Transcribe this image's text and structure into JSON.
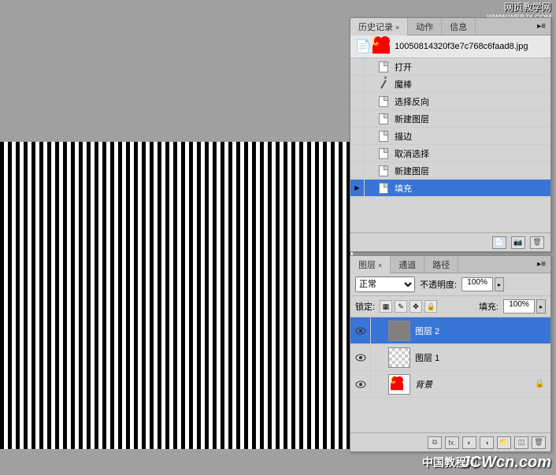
{
  "watermarks": {
    "top_title": "网页教学网",
    "top_url": "WWW.WEBJX.COM",
    "bottom_cn": "中国教程网",
    "bottom_en": "JCWcn.com"
  },
  "history_panel": {
    "tabs": [
      "历史记录",
      "动作",
      "信息"
    ],
    "active_tab": 0,
    "file_name": "10050814320f3e7c768c6faad8.jpg",
    "items": [
      {
        "icon": "doc",
        "label": "打开"
      },
      {
        "icon": "wand",
        "label": "魔棒"
      },
      {
        "icon": "doc",
        "label": "选择反向"
      },
      {
        "icon": "doc",
        "label": "新建图层"
      },
      {
        "icon": "doc",
        "label": "描边"
      },
      {
        "icon": "doc",
        "label": "取消选择"
      },
      {
        "icon": "doc",
        "label": "新建图层"
      },
      {
        "icon": "doc",
        "label": "填充",
        "selected": true
      }
    ]
  },
  "layers_panel": {
    "tabs": [
      "图层",
      "通道",
      "路径"
    ],
    "active_tab": 0,
    "blend_mode": "正常",
    "opacity_label": "不透明度:",
    "opacity_value": "100%",
    "lock_label": "锁定:",
    "fill_label": "填充:",
    "fill_value": "100%",
    "layers": [
      {
        "visible": true,
        "thumb": "gray",
        "name": "图层 2",
        "selected": true,
        "locked": false
      },
      {
        "visible": true,
        "thumb": "checker",
        "name": "图层 1",
        "selected": false,
        "locked": false
      },
      {
        "visible": true,
        "thumb": "heart",
        "name": "背景",
        "selected": false,
        "locked": true,
        "italic": true
      }
    ]
  }
}
